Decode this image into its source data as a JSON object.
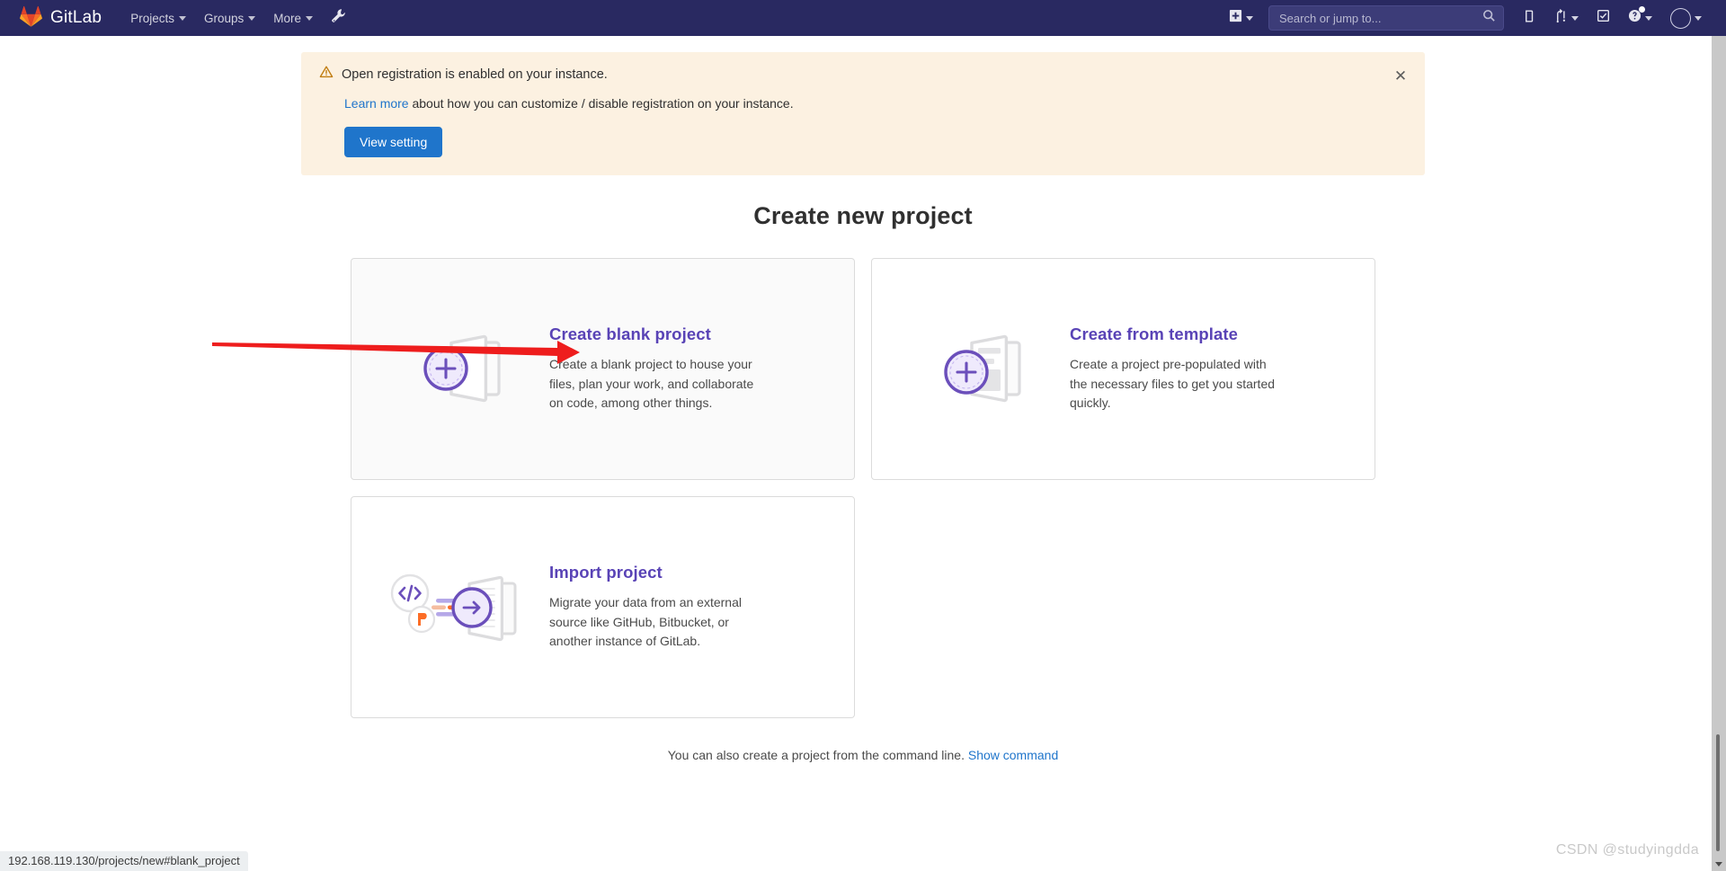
{
  "navbar": {
    "brand_name": "GitLab",
    "brand_icon": "gitlab-tanuki-logo",
    "left_items": [
      {
        "label": "Projects",
        "icon": "chevron-down-icon"
      },
      {
        "label": "Groups",
        "icon": "chevron-down-icon"
      },
      {
        "label": "More",
        "icon": "chevron-down-icon"
      }
    ],
    "admin_icon": "wrench-icon",
    "create_new_icon": "plus-square-icon",
    "search": {
      "placeholder": "Search or jump to...",
      "value": "",
      "icon": "search-icon"
    },
    "right_icons": [
      {
        "name": "issues-icon",
        "has_caret": false
      },
      {
        "name": "merge-requests-icon",
        "has_caret": true
      },
      {
        "name": "todos-icon",
        "has_caret": false
      },
      {
        "name": "help-icon",
        "has_caret": true,
        "badge": true
      }
    ],
    "avatar": {
      "name": "user-avatar",
      "has_caret": true
    }
  },
  "alert": {
    "icon": "warning-triangle-icon",
    "title": "Open registration is enabled on your instance.",
    "body_link": "Learn more",
    "body_rest": " about how you can customize / disable registration on your instance.",
    "button_label": "View setting",
    "close_icon": "close-icon",
    "bg_color": "#fcf1e1",
    "button_color": "#1f75cb"
  },
  "page": {
    "title": "Create new project"
  },
  "cards": [
    {
      "id": "blank-project",
      "title": "Create blank project",
      "description": "Create a blank project to house your files, plan your work, and collaborate on code, among other things.",
      "icon": "folder-plus-icon",
      "highlighted": true
    },
    {
      "id": "from-template",
      "title": "Create from template",
      "description": "Create a project pre-populated with the necessary files to get you started quickly.",
      "icon": "template-plus-icon",
      "highlighted": false
    },
    {
      "id": "import-project",
      "title": "Import project",
      "description": "Migrate your data from an external source like GitHub, Bitbucket, or another instance of GitLab.",
      "icon": "import-arrow-icon",
      "highlighted": false
    }
  ],
  "footer": {
    "text": "You can also create a project from the command line.",
    "link": "Show command"
  },
  "status_bar": {
    "url": "192.168.119.130/projects/new#blank_project"
  },
  "watermark": {
    "text": "CSDN @studyingdda"
  },
  "annotation": {
    "type": "red-arrow",
    "color": "#ee1d1d",
    "points_to": "Create blank project"
  },
  "colors": {
    "navbar": "#292961",
    "accent_purple": "#5943b6",
    "link_blue": "#1f75cb",
    "card_border": "#dbdbdb"
  }
}
